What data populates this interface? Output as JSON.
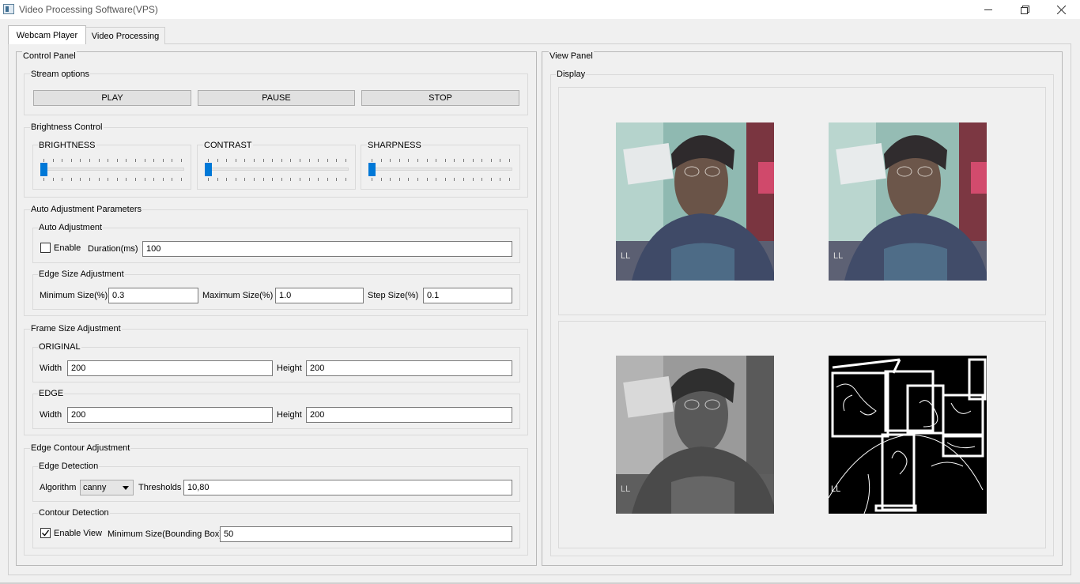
{
  "window": {
    "title": "Video Processing Software(VPS)"
  },
  "tabs": [
    {
      "label": "Webcam Player",
      "active": true
    },
    {
      "label": "Video Processing",
      "active": false
    }
  ],
  "control_panel": {
    "title": "Control Panel",
    "stream_options": {
      "title": "Stream options",
      "play_label": "PLAY",
      "pause_label": "PAUSE",
      "stop_label": "STOP"
    },
    "brightness_control": {
      "title": "Brightness Control",
      "sliders": [
        {
          "label": "BRIGHTNESS",
          "value": 0
        },
        {
          "label": "CONTRAST",
          "value": 0
        },
        {
          "label": "SHARPNESS",
          "value": 0
        }
      ]
    },
    "auto_adjustment_parameters": {
      "title": "Auto Adjustment Parameters",
      "auto_adjustment": {
        "title": "Auto Adjustment",
        "enable_label": "Enable",
        "enable_checked": false,
        "duration_label": "Duration(ms)",
        "duration_value": "100"
      },
      "edge_size_adjustment": {
        "title": "Edge Size Adjustment",
        "min_label": "Minimum Size(%)",
        "min_value": "0.3",
        "max_label": "Maximum Size(%)",
        "max_value": "1.0",
        "step_label": "Step Size(%)",
        "step_value": "0.1"
      }
    },
    "frame_size_adjustment": {
      "title": "Frame Size Adjustment",
      "original": {
        "title": "ORIGINAL",
        "width_label": "Width",
        "width_value": "200",
        "height_label": "Height",
        "height_value": "200"
      },
      "edge": {
        "title": "EDGE",
        "width_label": "Width",
        "width_value": "200",
        "height_label": "Height",
        "height_value": "200"
      }
    },
    "edge_contour_adjustment": {
      "title": "Edge  Contour Adjustment",
      "edge_detection": {
        "title": "Edge Detection",
        "algorithm_label": "Algorithm",
        "algorithm_value": "canny",
        "thresholds_label": "Thresholds",
        "thresholds_value": "10,80"
      },
      "contour_detection": {
        "title": "Contour Detection",
        "enable_view_label": "Enable View",
        "enable_view_checked": true,
        "min_size_label": "Minimum Size(Bounding Box)",
        "min_size_value": "50"
      }
    }
  },
  "view_panel": {
    "title": "View Panel",
    "display": {
      "title": "Display",
      "frames": [
        "original",
        "adjusted",
        "grayscale",
        "edge-contour"
      ]
    }
  },
  "colors": {
    "accent": "#0078d7",
    "window_bg": "#f0f0f0"
  }
}
